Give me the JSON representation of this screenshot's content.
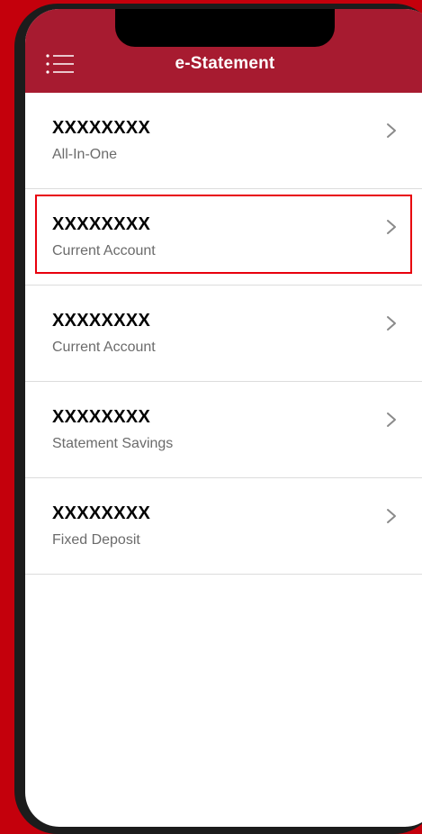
{
  "header": {
    "title": "e-Statement",
    "background_color": "#a71b30",
    "menu_icon": "hamburger-menu-icon"
  },
  "accounts": [
    {
      "number": "XXXXXXXX",
      "type": "All-In-One"
    },
    {
      "number": "XXXXXXXX",
      "type": "Current Account",
      "highlighted": true
    },
    {
      "number": "XXXXXXXX",
      "type": "Current Account"
    },
    {
      "number": "XXXXXXXX",
      "type": "Statement Savings"
    },
    {
      "number": "XXXXXXXX",
      "type": "Fixed Deposit"
    }
  ],
  "row_icon": "chevron-right-icon",
  "highlight_color": "#e8000d",
  "page_background_color": "#c4000c"
}
